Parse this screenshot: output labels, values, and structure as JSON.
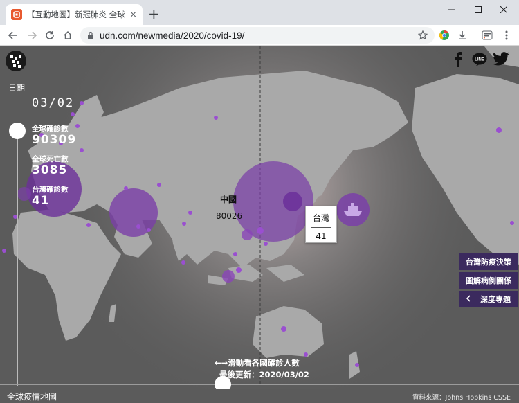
{
  "browser": {
    "tab_title": "【互動地圖】新冠肺炎 全球疫情",
    "tab_close": "×",
    "new_tab": "+",
    "url": "udn.com/newmedia/2020/covid-19/"
  },
  "page": {
    "date_label": "日期",
    "date_value": "03/02",
    "stats": [
      {
        "label": "全球確診數",
        "value": "90309"
      },
      {
        "label": "全球死亡數",
        "value": "3085"
      },
      {
        "label": "台灣確診數",
        "value": "41"
      }
    ],
    "highlight": {
      "name": "中國",
      "cases": "80026"
    },
    "tooltip": {
      "name": "台灣",
      "cases": "41"
    },
    "side_buttons": [
      "台灣防疫決策",
      "圖解病例關係",
      "深度專題"
    ],
    "side_buttons_icon": "chevron-left-icon",
    "hint": "←→滑動看各國確診人數",
    "updated": "最後更新：2020/03/02",
    "footer_title": "全球疫情地圖",
    "footer_source": "資料來源：Johns Hopkins CSSE",
    "social_icons": [
      "facebook-icon",
      "line-icon",
      "twitter-icon"
    ]
  },
  "colors": {
    "bubble": "#7a3fa8",
    "dot": "#9a4fd0",
    "button_bg": "#3b2a5e",
    "land": "#a9a9a9",
    "ocean": "#5b5b5b"
  }
}
